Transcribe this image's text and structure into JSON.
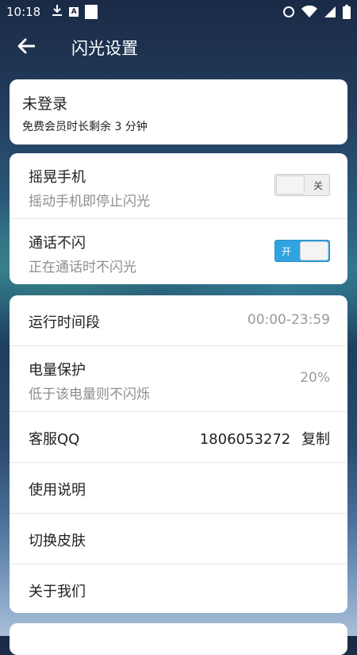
{
  "status_bar": {
    "time": "10:18",
    "a_icon": "A"
  },
  "app_bar": {
    "back_icon": "arrow-left",
    "title": "闪光设置"
  },
  "account_card": {
    "title": "未登录",
    "subtitle": "免费会员时长剩余 3 分钟"
  },
  "toggles_card": {
    "shake": {
      "title": "摇晃手机",
      "subtitle": "摇动手机即停止闪光",
      "switch_label": "关",
      "enabled": false
    },
    "call": {
      "title": "通话不闪",
      "subtitle": "正在通话时不闪光",
      "switch_label": "开",
      "enabled": true
    }
  },
  "settings_card": {
    "run_time": {
      "label": "运行时间段",
      "value": "00:00-23:59"
    },
    "battery": {
      "label": "电量保护",
      "subtitle": "低于该电量则不闪烁",
      "value": "20%"
    },
    "service": {
      "label": "客服QQ",
      "value": "1806053272",
      "copy": "复制"
    },
    "manual": {
      "label": "使用说明"
    },
    "skin": {
      "label": "切换皮肤"
    },
    "about": {
      "label": "关于我们"
    }
  },
  "colors": {
    "switch_on": "#2fa3e0",
    "card_bg": "#ffffff"
  }
}
